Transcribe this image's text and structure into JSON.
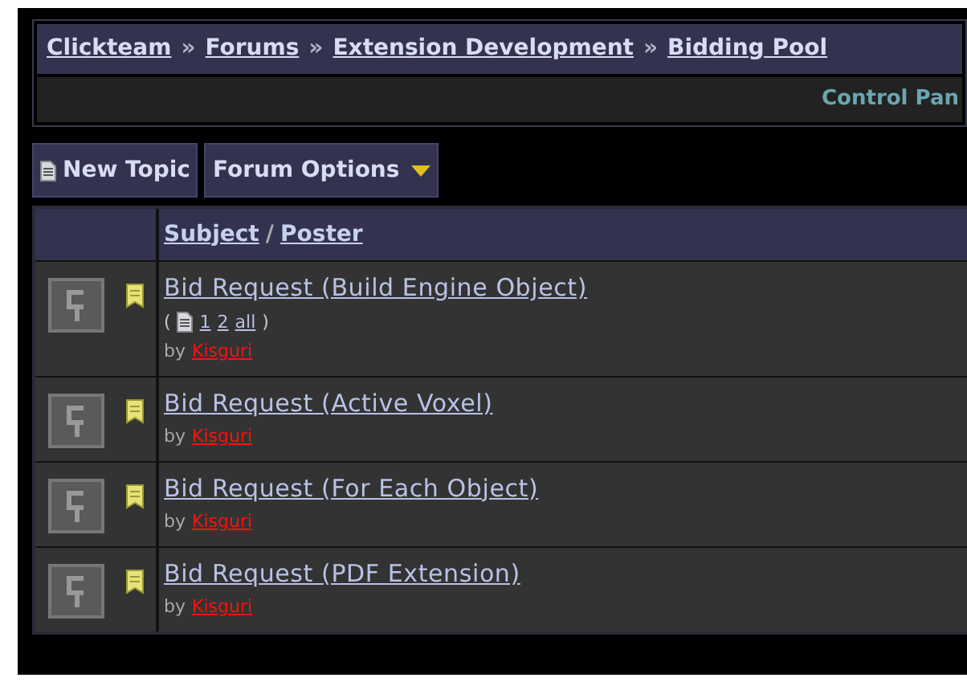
{
  "breadcrumb": [
    {
      "label": "Clickteam"
    },
    {
      "sep": "»",
      "label": "Forums"
    },
    {
      "sep": "»",
      "label": "Extension Development"
    },
    {
      "sep": "»",
      "label": "Bidding Pool"
    }
  ],
  "control_panel": "Control Pan",
  "buttons": [
    {
      "kind": "new",
      "label": "New Topic"
    },
    {
      "kind": "dropdown",
      "label": "Forum Options"
    }
  ],
  "table": {
    "header": {
      "subject": "Subject",
      "sep": "/",
      "poster": "Poster"
    },
    "topics": [
      {
        "title": "Bid Request (Build Engine Object)",
        "pages": {
          "open": "(",
          "links": [
            "1",
            "2",
            "all"
          ],
          "close": ")"
        },
        "by": "by",
        "poster": "Kisguri"
      },
      {
        "title": "Bid Request (Active Voxel)",
        "by": "by",
        "poster": "Kisguri"
      },
      {
        "title": "Bid Request (For Each Object)",
        "by": "by",
        "poster": "Kisguri"
      },
      {
        "title": "Bid Request (PDF Extension)",
        "by": "by",
        "poster": "Kisguri"
      }
    ]
  }
}
